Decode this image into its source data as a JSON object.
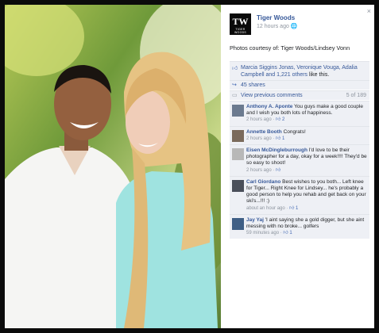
{
  "post": {
    "author": "Tiger Woods",
    "time": "12 hours ago",
    "time_icon": "globe-icon",
    "caption": "Photos courtesy of: Tiger Woods/Lindsey Vonn",
    "avatar_monogram": "TW",
    "avatar_text": "TIGER WOODS"
  },
  "likes": {
    "text": "Marcia Siggins Jonas, Veronique Vouga, Adalia Campbell and ",
    "others_link": "1,221 others",
    "suffix": " like this."
  },
  "shares": {
    "label": "45 shares"
  },
  "previous": {
    "label": "View previous comments",
    "count": "5 of 189"
  },
  "comments": [
    {
      "name": "Anthony A. Aponte",
      "text": "You guys make a good couple and I wish you both lots of happiness.",
      "time": "2 hours ago",
      "likes": "2"
    },
    {
      "name": "Annette Booth",
      "text": "Congrats!",
      "time": "2 hours ago",
      "likes": "1"
    },
    {
      "name": "Eisen McDingleburrough",
      "text": "I'd love to be their photographer for a day, okay for a week!!!! They'd be so easy to shoot!",
      "time": "2 hours ago",
      "likes": ""
    },
    {
      "name": "Carl Giordano",
      "text": "Best wishes to you both... Left knee for Tiger... Right Knee for Lindsey... he's probably a good person to help you rehab and get back on your ski's...!!! :)",
      "time": "about an hour ago",
      "likes": "1"
    },
    {
      "name": "Jay Yaj",
      "text": "'I aint saying she a gold digger, but she aint messing with no broke... golfers",
      "time": "59 minutes ago",
      "likes": "1"
    }
  ],
  "ui": {
    "close": "×",
    "like_word": "Like",
    "sep": " · "
  }
}
